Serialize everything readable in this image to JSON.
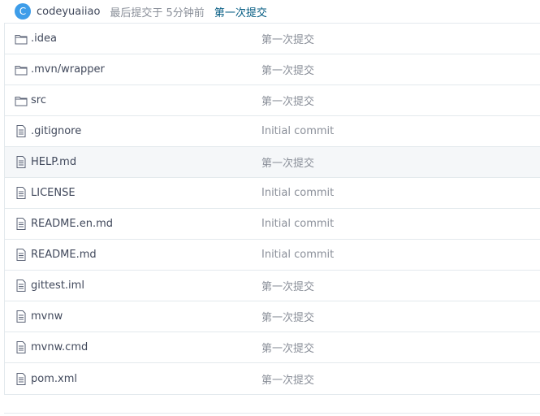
{
  "commit": {
    "avatar_letter": "C",
    "author": "codeyuaiiao",
    "time_text": "最后提交于 5分钟前",
    "message": "第一次提交",
    "avatar_color": "#3e9de9"
  },
  "files": [
    {
      "name": ".idea",
      "message": "第一次提交",
      "icon": "folder-icon",
      "type": "folder"
    },
    {
      "name": ".mvn/wrapper",
      "message": "第一次提交",
      "icon": "folder-icon",
      "type": "folder"
    },
    {
      "name": "src",
      "message": "第一次提交",
      "icon": "folder-icon",
      "type": "folder"
    },
    {
      "name": ".gitignore",
      "message": "Initial commit",
      "icon": "file-icon",
      "type": "file"
    },
    {
      "name": "HELP.md",
      "message": "第一次提交",
      "icon": "file-icon",
      "type": "file"
    },
    {
      "name": "LICENSE",
      "message": "Initial commit",
      "icon": "file-icon",
      "type": "file"
    },
    {
      "name": "README.en.md",
      "message": "Initial commit",
      "icon": "file-icon",
      "type": "file"
    },
    {
      "name": "README.md",
      "message": "Initial commit",
      "icon": "file-icon",
      "type": "file"
    },
    {
      "name": "gittest.iml",
      "message": "第一次提交",
      "icon": "file-icon",
      "type": "file"
    },
    {
      "name": "mvnw",
      "message": "第一次提交",
      "icon": "file-icon",
      "type": "file"
    },
    {
      "name": "mvnw.cmd",
      "message": "第一次提交",
      "icon": "file-icon",
      "type": "file"
    },
    {
      "name": "pom.xml",
      "message": "第一次提交",
      "icon": "file-icon",
      "type": "file"
    }
  ],
  "hovered_row": "HELP.md"
}
